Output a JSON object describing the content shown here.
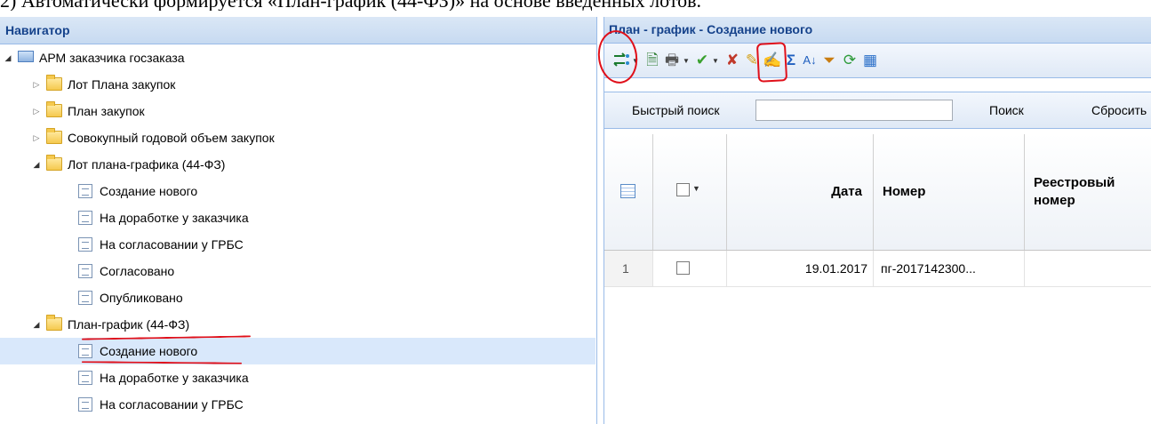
{
  "caption": "2) Автоматически формируется «План-график (44-ФЗ)» на основе введенных лотов.",
  "navigator": {
    "title": "Навигатор",
    "tree": [
      {
        "label": "АРМ заказчика госзаказа",
        "icon": "monitor-icon",
        "expander": "open",
        "level": 0
      },
      {
        "label": "Лот Плана закупок",
        "icon": "folder-icon",
        "expander": "closed",
        "level": 1
      },
      {
        "label": "План закупок",
        "icon": "folder-icon",
        "expander": "closed",
        "level": 1
      },
      {
        "label": "Совокупный годовой объем закупок",
        "icon": "folder-icon",
        "expander": "closed",
        "level": 1
      },
      {
        "label": "Лот плана-графика (44-ФЗ)",
        "icon": "folder-icon",
        "expander": "open",
        "level": 1
      },
      {
        "label": "Создание нового",
        "icon": "document-icon",
        "level": 2
      },
      {
        "label": "На доработке у заказчика",
        "icon": "document-icon",
        "level": 2
      },
      {
        "label": "На согласовании у ГРБС",
        "icon": "document-icon",
        "level": 2
      },
      {
        "label": "Согласовано",
        "icon": "document-icon",
        "level": 2
      },
      {
        "label": "Опубликовано",
        "icon": "document-icon",
        "level": 2
      },
      {
        "label": "План-график (44-ФЗ)",
        "icon": "folder-icon",
        "expander": "open",
        "level": 1
      },
      {
        "label": "Создание нового",
        "icon": "document-icon",
        "level": 2,
        "selected": true
      },
      {
        "label": "На доработке у заказчика",
        "icon": "document-icon",
        "level": 2
      },
      {
        "label": "На согласовании у ГРБС",
        "icon": "document-icon",
        "level": 2
      }
    ]
  },
  "panel": {
    "title": "План - график - Создание нового",
    "toolbar": {
      "icons": [
        "workflow-icon",
        "approve-doc-icon",
        "print-icon",
        "checkmark-icon",
        "cancel-check-icon",
        "edit-doc-icon",
        "sign-icon",
        "sum-icon",
        "sort-icon",
        "filter-icon",
        "refresh-icon",
        "table-settings-icon"
      ]
    },
    "search": {
      "label": "Быстрый поиск",
      "value": "",
      "search_button": "Поиск",
      "reset_button": "Сбросить"
    },
    "grid": {
      "columns": [
        "Дата",
        "Номер",
        "Реестровый номер"
      ],
      "rows": [
        {
          "index": "1",
          "date": "19.01.2017",
          "number": "пг-2017142300..."
        }
      ]
    }
  },
  "colors": {
    "header_text": "#15428b",
    "panel_border": "#99bbe8",
    "selection": "#d9e8fb",
    "annotation": "#e0101a"
  }
}
